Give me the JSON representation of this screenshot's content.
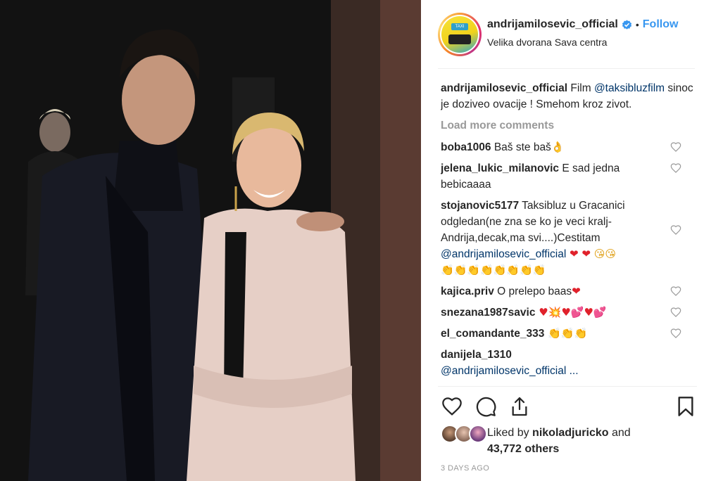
{
  "post": {
    "username": "andrijamilosevic_official",
    "verified": true,
    "follow_label": "Follow",
    "separator": "•",
    "location": "Velika dvorana Sava centra"
  },
  "caption": {
    "username": "andrijamilosevic_official",
    "text_before": " Film ",
    "mention": "@taksibluzfilm",
    "text_after": " sinoc je doziveo ovacije ! Smehom kroz zivot."
  },
  "load_more_label": "Load more comments",
  "comments": [
    {
      "username": "boba1006",
      "text": " Baš ste baš",
      "emoji": "👌"
    },
    {
      "username": "jelena_lukic_milanovic",
      "text": " E sad jedna bebicaaaa"
    },
    {
      "username": "stojanovic5177",
      "text": " Taksibluz u Gracanici odgledan(ne zna se ko je veci kralj-Andrija,decak,ma svi....)Cestitam ",
      "mention": "@andrijamilosevic_official",
      "emoji_red": " ❤ ❤ ",
      "emoji_face": "😘😘",
      "emoji_claps": "👏👏👏👏👏👏👏👏"
    },
    {
      "username": "kajica.priv",
      "text": " O prelepo baas",
      "emoji": "❤"
    },
    {
      "username": "snezana1987savic",
      "emoji": " ♥💥♥💕♥💕"
    },
    {
      "username": "el_comandante_333",
      "emoji": " 👏👏👏"
    },
    {
      "username": "danijela_1310",
      "mention": "@andrijamilosevic_official ..."
    }
  ],
  "likes": {
    "prefix": "Liked by ",
    "user": "nikoladjuricko",
    "middle": " and",
    "others": "43,772 others"
  },
  "time_ago": "3 DAYS AGO",
  "icons": {
    "like": "heart-outline-icon",
    "comment": "speech-bubble-icon",
    "share": "share-arrow-icon",
    "save": "bookmark-icon",
    "verified": "verified-badge-icon"
  },
  "colors": {
    "link_blue": "#3897f0",
    "mention_blue": "#003569",
    "muted": "#999999",
    "text": "#262626"
  }
}
